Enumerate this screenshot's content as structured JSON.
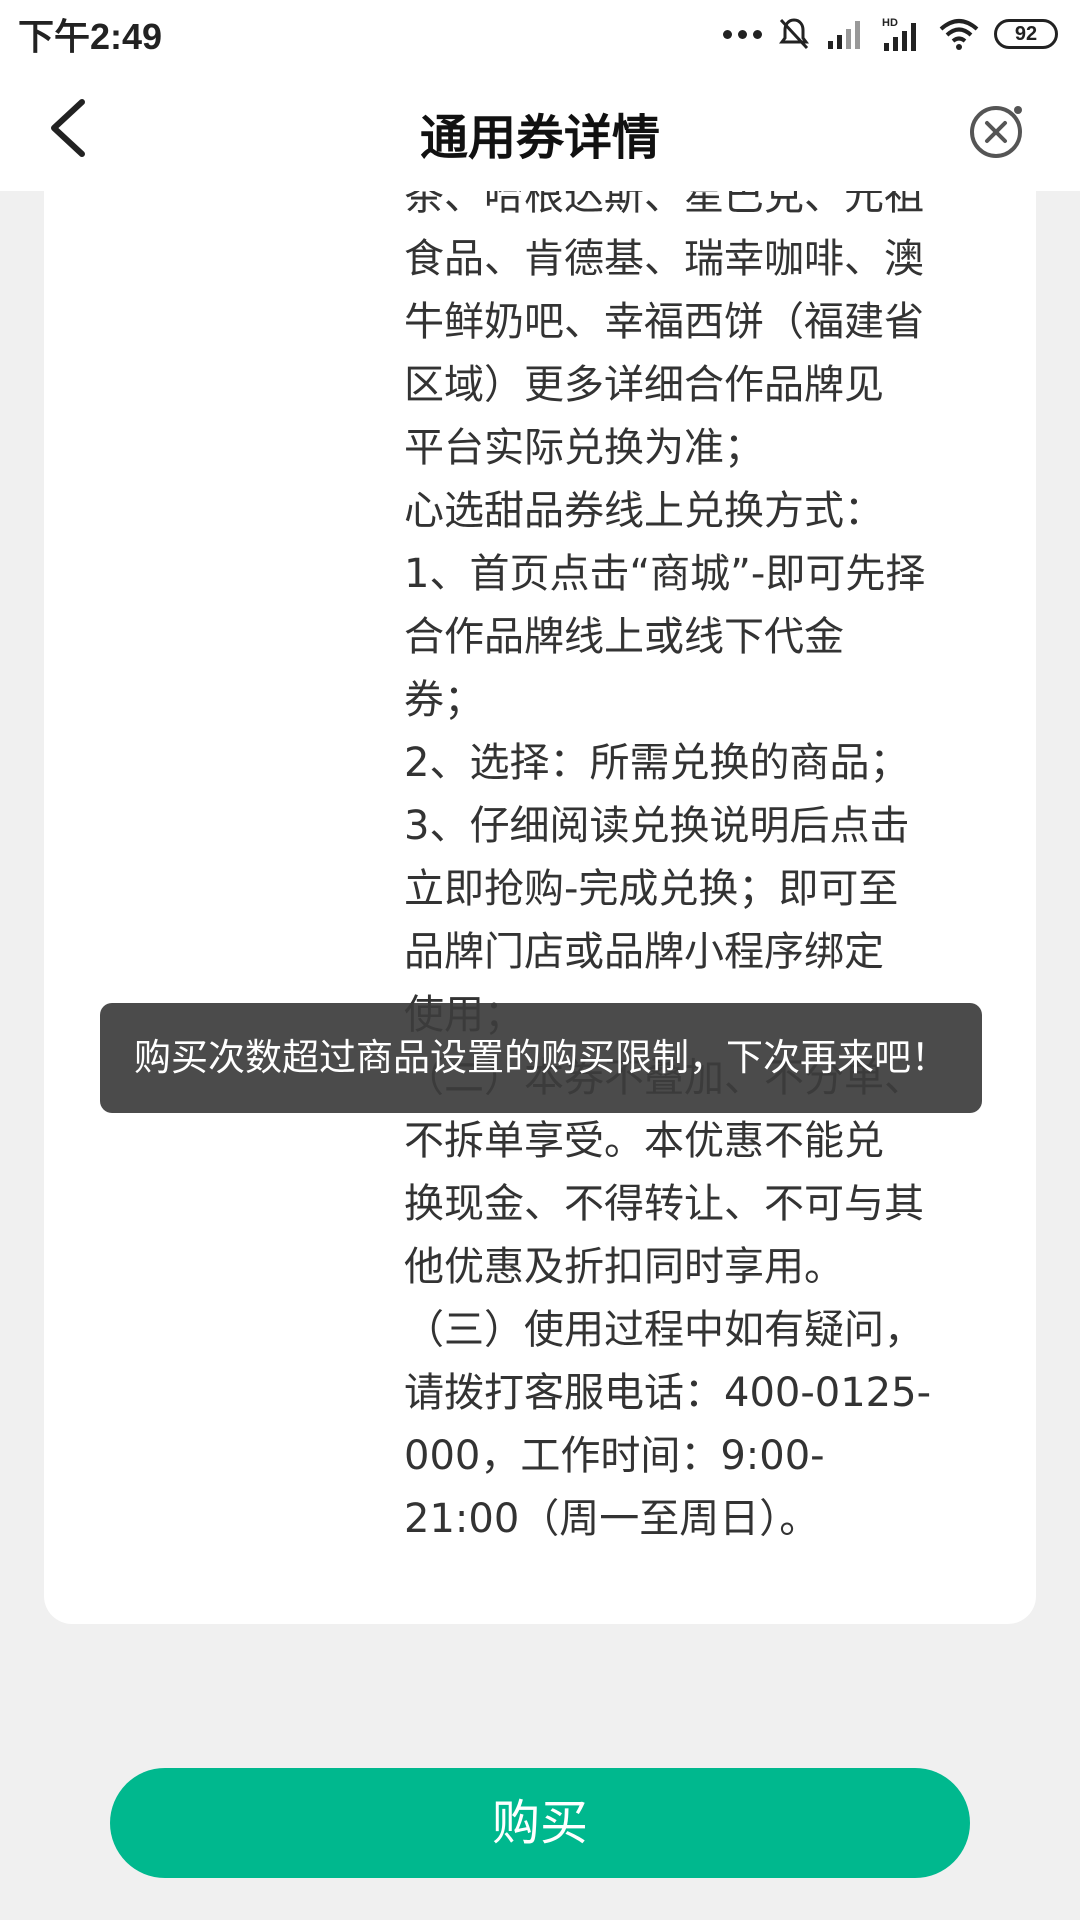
{
  "status_bar": {
    "time": "下午2:49",
    "battery": "92",
    "icons": [
      "more-dots-icon",
      "mute-bell-icon",
      "signal-icon",
      "hd-signal-icon",
      "wifi-icon",
      "battery-icon"
    ]
  },
  "header": {
    "title": "通用券详情",
    "back_icon": "chevron-left-icon",
    "close_icon": "close-circle-icon"
  },
  "rules_lines": [
    "茶、哈根达斯、星巴克、元祖",
    "食品、肯德基、瑞幸咖啡、澳",
    "牛鲜奶吧、幸福西饼（福建省",
    "区域）更多详细合作品牌见",
    "平台实际兑换为准；",
    "心选甜品券线上兑换方式：",
    "1、首页点击“商城”-即可先择",
    "合作品牌线上或线下代金",
    "券；",
    "2、选择：所需兑换的商品；",
    "3、仔细阅读兑换说明后点击",
    "立即抢购-完成兑换；即可至",
    "品牌门店或品牌小程序绑定",
    "使用；",
    "（二）本券不叠加、不分单、",
    "不拆单享受。本优惠不能兑",
    "换现金、不得转让、不可与其",
    "他优惠及折扣同时享用。",
    "（三）使用过程中如有疑问，",
    "请拨打客服电话：400-0125-",
    "000，工作时间：9:00-",
    "21:00（周一至周日）。"
  ],
  "toast": {
    "message": "购买次数超过商品设置的购买限制，下次再来吧！"
  },
  "buy_button": {
    "label": "购买"
  },
  "colors": {
    "accent": "#00b88e",
    "background": "#f0f0f0",
    "toast_bg": "#3c3c3c"
  }
}
